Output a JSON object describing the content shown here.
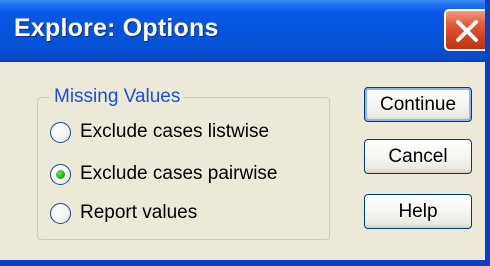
{
  "window": {
    "title": "Explore: Options",
    "close_icon": "close-icon",
    "colors": {
      "titlebar": "#0654dd",
      "dialog_bg": "#ece9d8",
      "close_button": "#d1401f",
      "group_legend": "#1f4fd1"
    }
  },
  "missing_values": {
    "legend": "Missing Values",
    "selected": "Exclude cases pairwise",
    "options": [
      {
        "label": "Exclude cases listwise",
        "checked": false
      },
      {
        "label": "Exclude cases pairwise",
        "checked": true
      },
      {
        "label": "Report values",
        "checked": false
      }
    ]
  },
  "buttons": {
    "continue_label": "Continue",
    "cancel_label": "Cancel",
    "help_label": "Help"
  }
}
